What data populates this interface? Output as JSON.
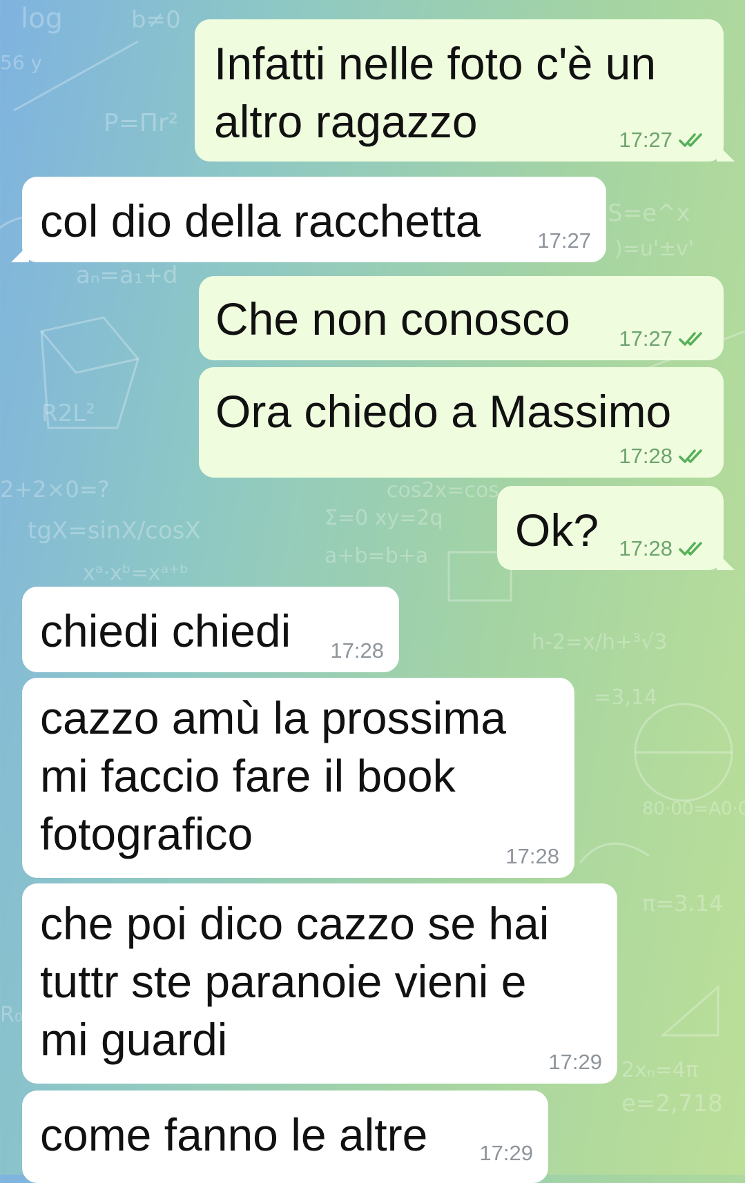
{
  "chat": {
    "messages": [
      {
        "direction": "out",
        "text": "Infatti nelle foto c'è un\naltro ragazzo",
        "time": "17:27",
        "read": true
      },
      {
        "direction": "in",
        "text": "col dio della racchetta",
        "time": "17:27"
      },
      {
        "direction": "out",
        "text": "Che non conosco",
        "time": "17:27",
        "read": true
      },
      {
        "direction": "out",
        "text": "Ora chiedo a Massimo",
        "time": "17:28",
        "read": true
      },
      {
        "direction": "out",
        "text": "Ok?",
        "time": "17:28",
        "read": true
      },
      {
        "direction": "in",
        "text": "chiedi chiedi",
        "time": "17:28"
      },
      {
        "direction": "in",
        "text": "cazzo amù la prossima\nmi faccio fare il book\nfotografico",
        "time": "17:28"
      },
      {
        "direction": "in",
        "text": "che poi dico cazzo se hai\ntuttr ste paranoie vieni e\nmi guardi",
        "time": "17:29"
      },
      {
        "direction": "in",
        "text": "come fanno le altre",
        "time": "17:29"
      }
    ]
  },
  "colors": {
    "outgoing_bubble": "#effdde",
    "incoming_bubble": "#ffffff",
    "read_check": "#57b05a",
    "timestamp": "#8e959c"
  },
  "icons": {
    "read_receipt": "double-check-icon"
  }
}
